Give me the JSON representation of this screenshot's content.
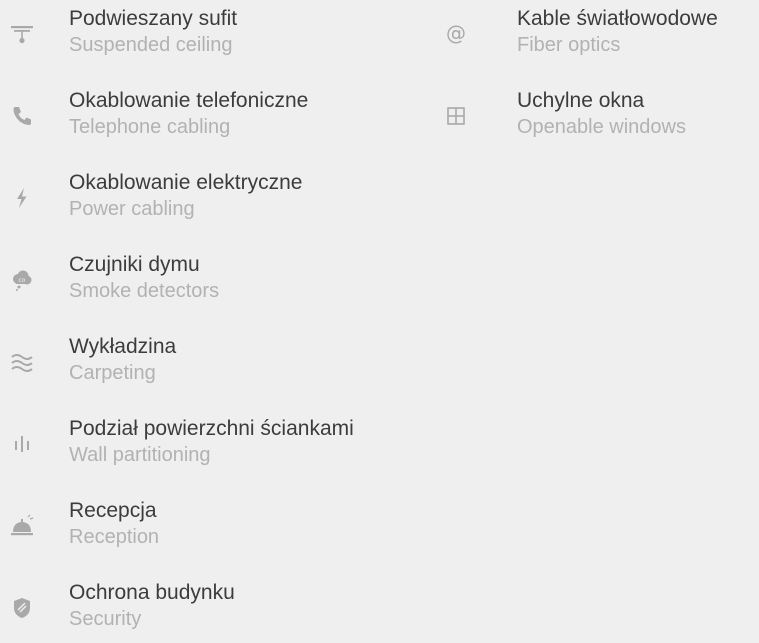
{
  "features_left": [
    {
      "title": "Podwieszany sufit",
      "subtitle": "Suspended ceiling",
      "icon": "ceiling-lamp-icon"
    },
    {
      "title": "Okablowanie telefoniczne",
      "subtitle": "Telephone cabling",
      "icon": "phone-icon"
    },
    {
      "title": "Okablowanie elektryczne",
      "subtitle": "Power cabling",
      "icon": "lightning-icon"
    },
    {
      "title": "Czujniki dymu",
      "subtitle": "Smoke detectors",
      "icon": "smoke-cloud-icon"
    },
    {
      "title": "Wykładzina",
      "subtitle": "Carpeting",
      "icon": "waves-icon"
    },
    {
      "title": "Podział powierzchni ściankami",
      "subtitle": "Wall partitioning",
      "icon": "partition-bars-icon"
    },
    {
      "title": "Recepcja",
      "subtitle": "Reception",
      "icon": "reception-bell-icon"
    },
    {
      "title": "Ochrona budynku",
      "subtitle": "Security",
      "icon": "shield-icon"
    }
  ],
  "features_right": [
    {
      "title": "Kable światłowodowe",
      "subtitle": "Fiber optics",
      "icon": "at-sign-icon"
    },
    {
      "title": "Uchylne okna",
      "subtitle": "Openable windows",
      "icon": "window-icon"
    }
  ]
}
